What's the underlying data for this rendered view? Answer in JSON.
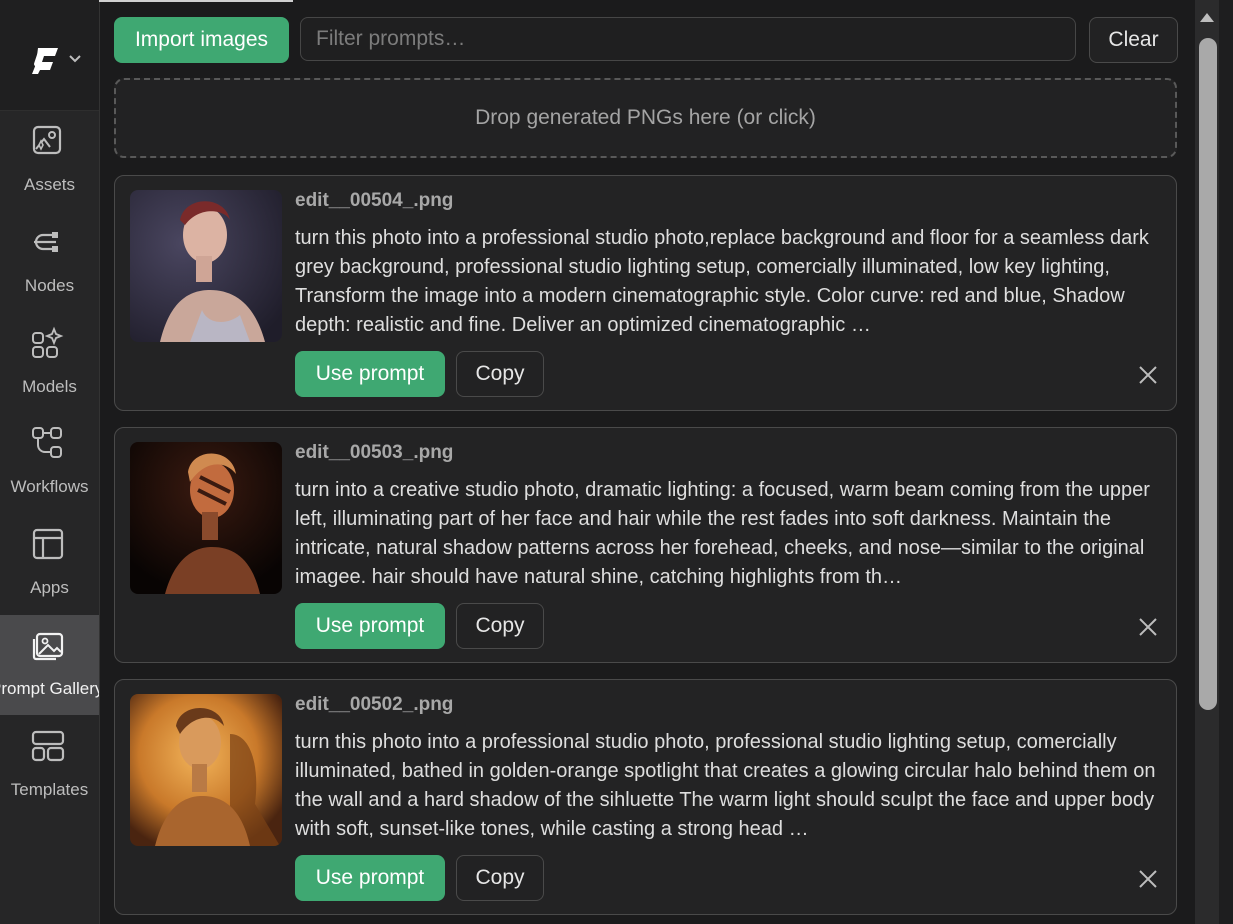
{
  "sidebar": {
    "logo": "comfy-logo",
    "items": [
      {
        "label": "Assets",
        "icon": "assets-icon"
      },
      {
        "label": "Nodes",
        "icon": "nodes-icon"
      },
      {
        "label": "Models",
        "icon": "models-icon"
      },
      {
        "label": "Workflows",
        "icon": "workflows-icon"
      },
      {
        "label": "Apps",
        "icon": "apps-icon"
      },
      {
        "label": "Prompt Gallery",
        "icon": "gallery-icon",
        "active": true
      },
      {
        "label": "Templates",
        "icon": "templates-icon"
      }
    ]
  },
  "toolbar": {
    "import_label": "Import images",
    "filter_placeholder": "Filter prompts…",
    "clear_label": "Clear"
  },
  "dropzone": {
    "text": "Drop generated PNGs here (or click)"
  },
  "cards": [
    {
      "filename": "edit__00504_.png",
      "prompt": "turn this photo into a professional studio photo,replace background and floor for a seamless dark grey background, professional studio lighting setup, comercially illuminated, low key lighting, Transform the image into a modern cinematographic style. Color curve: red and blue, Shadow depth: realistic and fine. Deliver an optimized cinematographic …",
      "use_label": "Use prompt",
      "copy_label": "Copy"
    },
    {
      "filename": "edit__00503_.png",
      "prompt": "turn into a creative studio photo, dramatic lighting: a focused, warm beam coming from the upper left, illuminating part of her face and hair while the rest fades into soft darkness. Maintain the intricate, natural shadow patterns across her forehead, cheeks, and nose—similar to the original imagee. hair should have natural shine, catching highlights from th…",
      "use_label": "Use prompt",
      "copy_label": "Copy"
    },
    {
      "filename": "edit__00502_.png",
      "prompt": "turn this photo into a professional studio photo, professional studio lighting setup, comercially illuminated, bathed in golden-orange spotlight that creates a glowing circular halo behind them on the wall and a hard shadow of the sihluette The warm light should sculpt the face and upper body with soft, sunset-like tones, while casting a strong head …",
      "use_label": "Use prompt",
      "copy_label": "Copy"
    }
  ],
  "colors": {
    "accent": "#3fa872",
    "background": "#1b1b1c",
    "sidebar": "#262627"
  }
}
